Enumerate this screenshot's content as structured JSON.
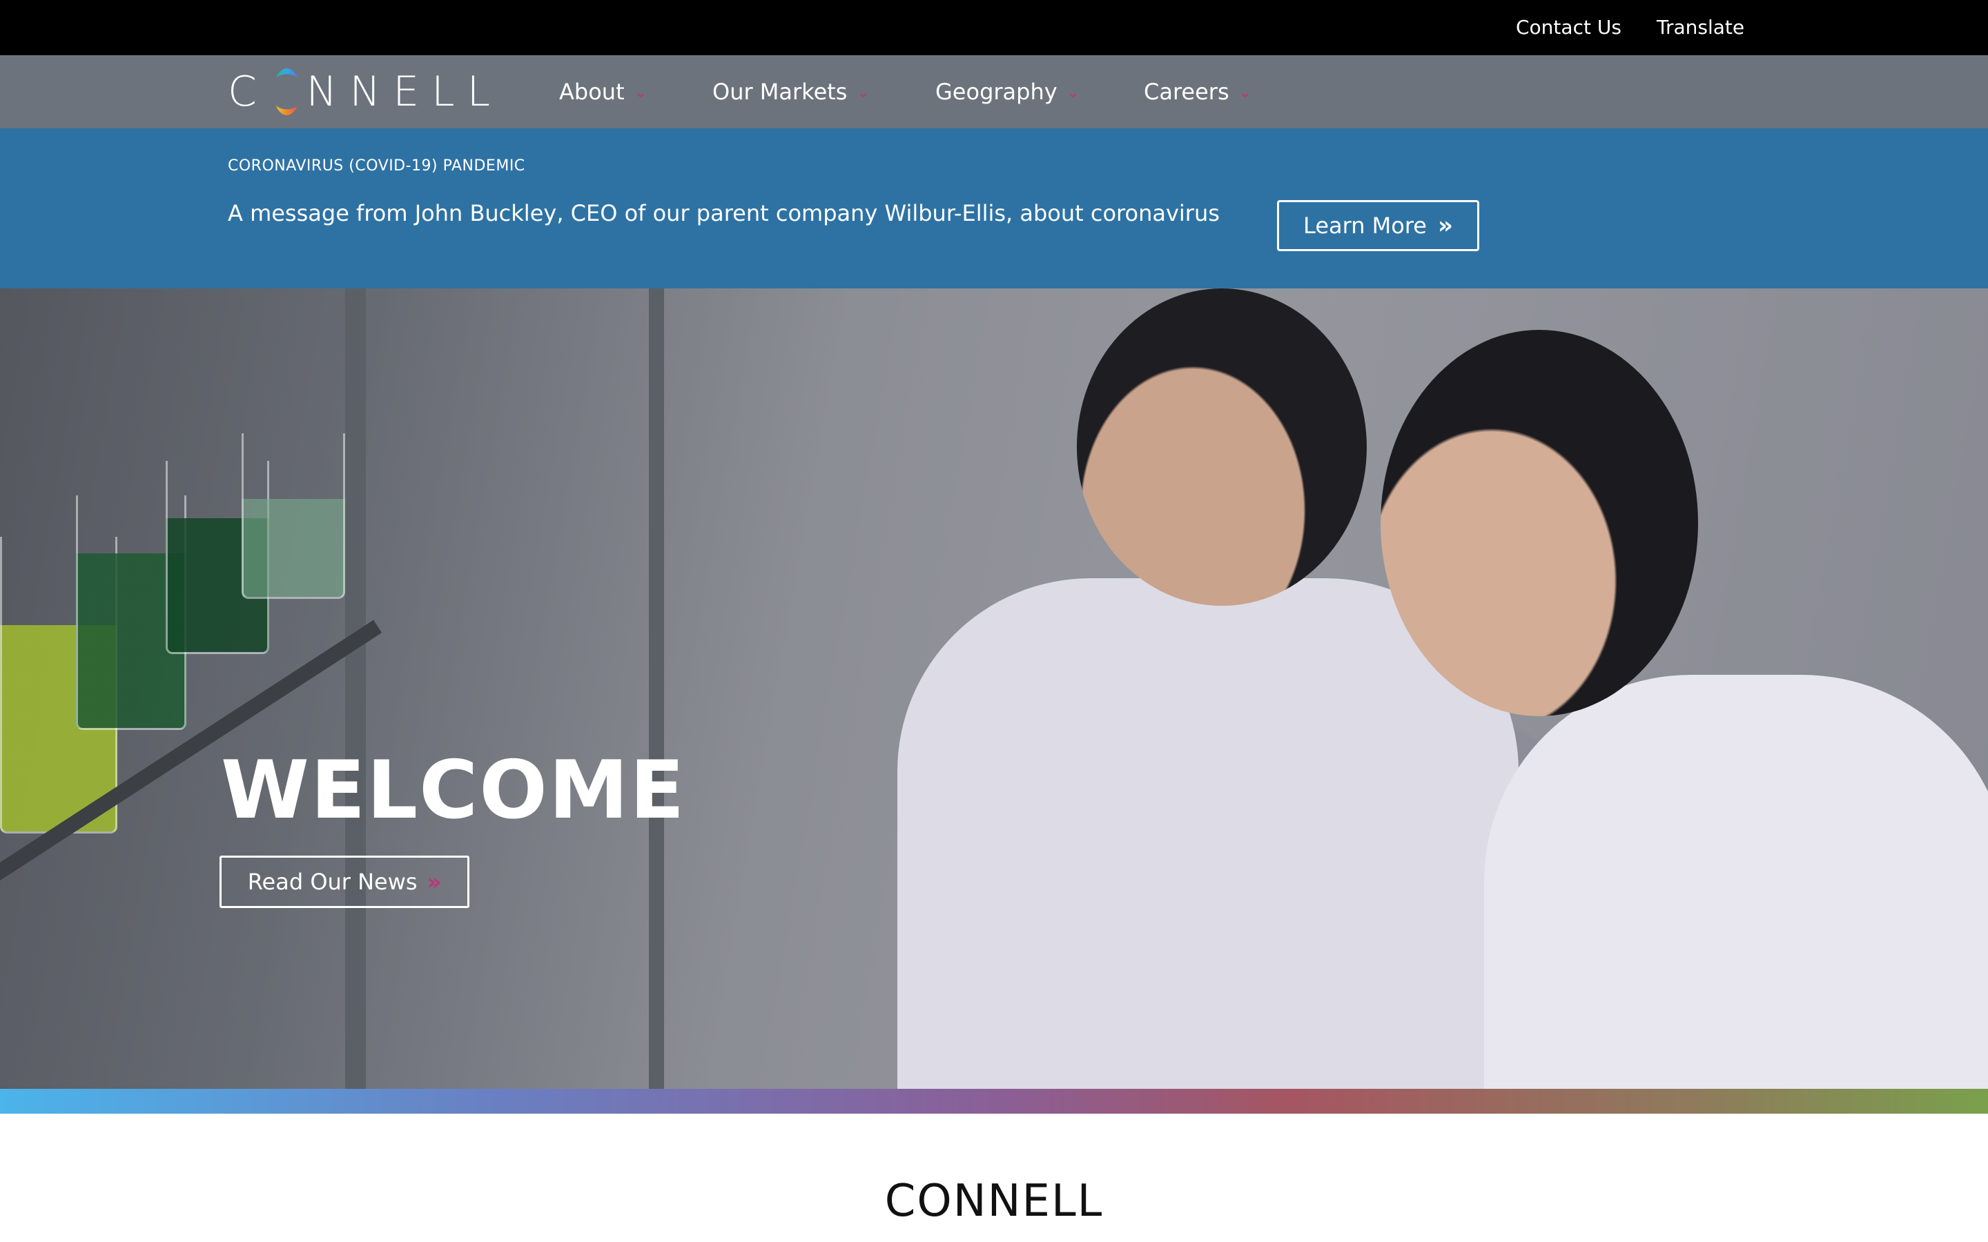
{
  "utility_nav": {
    "contact_label": "Contact Us",
    "translate_label": "Translate"
  },
  "header": {
    "logo_text_before": "C",
    "logo_text_after": "NNELL",
    "nav": [
      {
        "label": "About",
        "icon": "chevron-down-icon"
      },
      {
        "label": "Our Markets",
        "icon": "chevron-down-icon"
      },
      {
        "label": "Geography",
        "icon": "chevron-down-icon"
      },
      {
        "label": "Careers",
        "icon": "chevron-down-icon"
      }
    ],
    "chevron_glyph": "⌄"
  },
  "banner": {
    "kicker": "CORONAVIRUS (COVID-19) PANDEMIC",
    "message": "A message from John Buckley, CEO of our parent company Wilbur-Ellis, about coronavirus",
    "button_label": "Learn More",
    "button_icon": "double-chevron-right-icon",
    "arrow_glyph": "»"
  },
  "hero": {
    "title": "WELCOME",
    "button_label": "Read Our News",
    "button_icon": "double-chevron-right-icon",
    "arrow_glyph": "»"
  },
  "section": {
    "title": "CONNELL"
  },
  "colors": {
    "utility_bar": "#000000",
    "nav_bar": "#6c737c",
    "banner": "#2e72a4",
    "accent": "#c2337a"
  }
}
